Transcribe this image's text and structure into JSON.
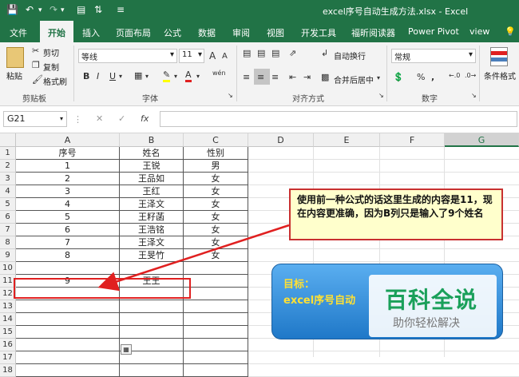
{
  "title_bar": {
    "title": "excel序号自动生成方法.xlsx - Excel"
  },
  "tabs": [
    "文件",
    "开始",
    "插入",
    "页面布局",
    "公式",
    "数据",
    "审阅",
    "视图",
    "开发工具",
    "福昕阅读器",
    "Power Pivot",
    "view"
  ],
  "ribbon": {
    "clipboard": {
      "paste": "粘贴",
      "cut": "剪切",
      "copy": "复制",
      "format_painter": "格式刷",
      "label": "剪贴板"
    },
    "font": {
      "name": "等线",
      "size": "11",
      "bold": "B",
      "italic": "I",
      "underline": "U",
      "label": "字体",
      "grow": "A",
      "shrink": "A",
      "phonetic": "wén"
    },
    "alignment": {
      "wrap": "自动换行",
      "merge": "合并后居中",
      "label": "对齐方式"
    },
    "number": {
      "format": "常规",
      "label": "数字",
      "percent": "%",
      "comma": ","
    },
    "styles": {
      "conditional": "条件格式"
    }
  },
  "formula_bar": {
    "name_box": "G21",
    "fx": "fx",
    "value": ""
  },
  "columns": [
    "A",
    "B",
    "C",
    "D",
    "E",
    "F",
    "G"
  ],
  "rows": [
    "1",
    "2",
    "3",
    "4",
    "5",
    "6",
    "7",
    "8",
    "9",
    "10",
    "11",
    "12",
    "13",
    "14",
    "15",
    "16",
    "17",
    "18"
  ],
  "table": [
    {
      "a": "序号",
      "b": "姓名",
      "c": "性别"
    },
    {
      "a": "1",
      "b": "王锐",
      "c": "男"
    },
    {
      "a": "2",
      "b": "王品如",
      "c": "女"
    },
    {
      "a": "3",
      "b": "王红",
      "c": "女"
    },
    {
      "a": "4",
      "b": "王泽文",
      "c": "女"
    },
    {
      "a": "5",
      "b": "王籽菡",
      "c": "女"
    },
    {
      "a": "6",
      "b": "王浩铭",
      "c": "女"
    },
    {
      "a": "7",
      "b": "王泽文",
      "c": "女"
    },
    {
      "a": "8",
      "b": "王旻竹",
      "c": "女"
    },
    {
      "a": "",
      "b": "",
      "c": ""
    },
    {
      "a": "9",
      "b": "王王",
      "c": ""
    }
  ],
  "callout": {
    "text": "使用前一种公式的话这里生成的内容是11，现在内容更准确，因为B列只是输入了9个姓名"
  },
  "goal_box": {
    "title": "目标：",
    "body": "excel序号自动"
  },
  "watermark": {
    "main": "百科全说",
    "sub": "助你轻松解决"
  },
  "colors": {
    "excel_green": "#217346",
    "callout_bg": "#ffffcc",
    "goal_bg": "#2e8fd8",
    "highlight_red": "#e02020"
  }
}
